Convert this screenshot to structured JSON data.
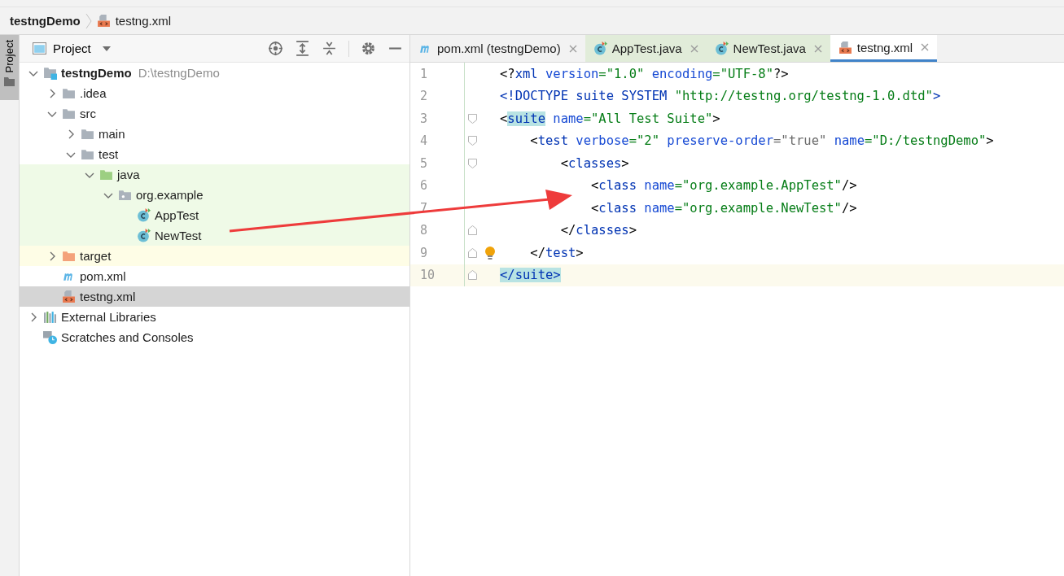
{
  "breadcrumb": [
    {
      "label": "testngDemo",
      "kind": "project",
      "bold": true
    },
    {
      "label": "testng.xml",
      "kind": "xml",
      "bold": false
    }
  ],
  "tool_strip": {
    "label": "Project",
    "selected": true
  },
  "project_panel": {
    "title": "Project",
    "tree": [
      {
        "label": "testngDemo",
        "hint": "D:\\testngDemo",
        "kind": "module",
        "bold": true,
        "expanded": true,
        "selected": false,
        "test_source": false,
        "excluded": false,
        "children": [
          {
            "label": ".idea",
            "kind": "folder",
            "bold": false,
            "expanded": false,
            "selected": false,
            "test_source": false,
            "excluded": false
          },
          {
            "label": "src",
            "kind": "folder",
            "bold": false,
            "expanded": true,
            "selected": false,
            "test_source": false,
            "excluded": false,
            "children": [
              {
                "label": "main",
                "kind": "folder",
                "bold": false,
                "expanded": false,
                "selected": false,
                "test_source": false,
                "excluded": false
              },
              {
                "label": "test",
                "kind": "folder",
                "bold": false,
                "expanded": true,
                "selected": false,
                "test_source": false,
                "excluded": false,
                "children": [
                  {
                    "label": "java",
                    "kind": "test-folder",
                    "bold": false,
                    "expanded": true,
                    "selected": false,
                    "test_source": true,
                    "excluded": false,
                    "children": [
                      {
                        "label": "org.example",
                        "kind": "package",
                        "bold": false,
                        "expanded": true,
                        "selected": false,
                        "test_source": true,
                        "excluded": false,
                        "children": [
                          {
                            "label": "AppTest",
                            "kind": "class",
                            "bold": false,
                            "selected": false,
                            "test_source": true,
                            "excluded": false
                          },
                          {
                            "label": "NewTest",
                            "kind": "class",
                            "bold": false,
                            "selected": false,
                            "test_source": true,
                            "excluded": false
                          }
                        ]
                      }
                    ]
                  }
                ]
              }
            ]
          },
          {
            "label": "target",
            "kind": "excluded-folder",
            "bold": false,
            "expanded": false,
            "selected": false,
            "test_source": false,
            "excluded": true
          },
          {
            "label": "pom.xml",
            "kind": "maven",
            "bold": false,
            "selected": false,
            "test_source": false,
            "excluded": false
          },
          {
            "label": "testng.xml",
            "kind": "xml",
            "bold": false,
            "selected": true,
            "test_source": false,
            "excluded": false
          }
        ]
      },
      {
        "label": "External Libraries",
        "kind": "libraries",
        "bold": false,
        "expanded": false,
        "selected": false,
        "test_source": false,
        "excluded": false
      },
      {
        "label": "Scratches and Consoles",
        "kind": "scratches",
        "bold": false,
        "selected": false,
        "test_source": false,
        "excluded": false
      }
    ]
  },
  "tabs": [
    {
      "label": "pom.xml (testngDemo)",
      "kind": "maven",
      "selected": false,
      "test_source": false
    },
    {
      "label": "AppTest.java",
      "kind": "class",
      "selected": false,
      "test_source": true
    },
    {
      "label": "NewTest.java",
      "kind": "class",
      "selected": false,
      "test_source": true
    },
    {
      "label": "testng.xml",
      "kind": "xml",
      "selected": true,
      "test_source": false
    }
  ],
  "code_lines": [
    {
      "number": "1",
      "fold_start": false,
      "fold_end": false,
      "bulb": false,
      "current": false,
      "tokens": [
        {
          "kind": "punct",
          "text": "<?"
        },
        {
          "kind": "tag",
          "text": "xml "
        },
        {
          "kind": "attr",
          "text": "version"
        },
        {
          "kind": "value",
          "text": "=\"1.0\" "
        },
        {
          "kind": "attr",
          "text": "encoding"
        },
        {
          "kind": "value",
          "text": "=\"UTF-8\""
        },
        {
          "kind": "punct",
          "text": "?>"
        }
      ]
    },
    {
      "number": "2",
      "fold_start": false,
      "fold_end": false,
      "bulb": false,
      "current": false,
      "tokens": [
        {
          "kind": "tag",
          "text": "<!DOCTYPE suite SYSTEM "
        },
        {
          "kind": "value",
          "text": "\"http://testng.org/testng-1.0.dtd\""
        },
        {
          "kind": "tag",
          "text": ">"
        }
      ]
    },
    {
      "number": "3",
      "fold_start": true,
      "fold_end": false,
      "bulb": false,
      "current": false,
      "tokens": [
        {
          "kind": "punct",
          "text": "<"
        },
        {
          "kind": "match",
          "text": "suite"
        },
        {
          "kind": "attr",
          "text": " name"
        },
        {
          "kind": "value",
          "text": "=\"All Test Suite\""
        },
        {
          "kind": "punct",
          "text": ">"
        }
      ]
    },
    {
      "number": "4",
      "fold_start": true,
      "fold_end": false,
      "bulb": false,
      "current": false,
      "tokens": [
        {
          "kind": "punct",
          "text": "    <"
        },
        {
          "kind": "tag",
          "text": "test "
        },
        {
          "kind": "attr",
          "text": "verbose"
        },
        {
          "kind": "value",
          "text": "=\"2\" "
        },
        {
          "kind": "attr",
          "text": "preserve-order"
        },
        {
          "kind": "muted",
          "text": "=\"true\" "
        },
        {
          "kind": "attr",
          "text": "name"
        },
        {
          "kind": "value",
          "text": "=\"D:/testngDemo\""
        },
        {
          "kind": "punct",
          "text": ">"
        }
      ]
    },
    {
      "number": "5",
      "fold_start": true,
      "fold_end": false,
      "bulb": false,
      "current": false,
      "tokens": [
        {
          "kind": "punct",
          "text": "        <"
        },
        {
          "kind": "tag",
          "text": "classes"
        },
        {
          "kind": "punct",
          "text": ">"
        }
      ]
    },
    {
      "number": "6",
      "fold_start": false,
      "fold_end": false,
      "bulb": false,
      "current": false,
      "tokens": [
        {
          "kind": "punct",
          "text": "            <"
        },
        {
          "kind": "tag",
          "text": "class "
        },
        {
          "kind": "attr",
          "text": "name"
        },
        {
          "kind": "value",
          "text": "=\"org.example.AppTest\""
        },
        {
          "kind": "punct",
          "text": "/>"
        }
      ]
    },
    {
      "number": "7",
      "fold_start": false,
      "fold_end": false,
      "bulb": false,
      "current": false,
      "tokens": [
        {
          "kind": "punct",
          "text": "            <"
        },
        {
          "kind": "tag",
          "text": "class "
        },
        {
          "kind": "attr",
          "text": "name"
        },
        {
          "kind": "value",
          "text": "=\"org.example.NewTest\""
        },
        {
          "kind": "punct",
          "text": "/>"
        }
      ]
    },
    {
      "number": "8",
      "fold_start": false,
      "fold_end": true,
      "bulb": false,
      "current": false,
      "tokens": [
        {
          "kind": "punct",
          "text": "        </"
        },
        {
          "kind": "tag",
          "text": "classes"
        },
        {
          "kind": "punct",
          "text": ">"
        }
      ]
    },
    {
      "number": "9",
      "fold_start": false,
      "fold_end": true,
      "bulb": true,
      "current": false,
      "tokens": [
        {
          "kind": "punct",
          "text": "    </"
        },
        {
          "kind": "tag",
          "text": "test"
        },
        {
          "kind": "punct",
          "text": ">"
        }
      ]
    },
    {
      "number": "10",
      "fold_start": false,
      "fold_end": true,
      "bulb": false,
      "current": true,
      "tokens": [
        {
          "kind": "match",
          "text": "</"
        },
        {
          "kind": "match",
          "text": "suite"
        },
        {
          "kind": "match",
          "text": ">"
        }
      ]
    }
  ]
}
